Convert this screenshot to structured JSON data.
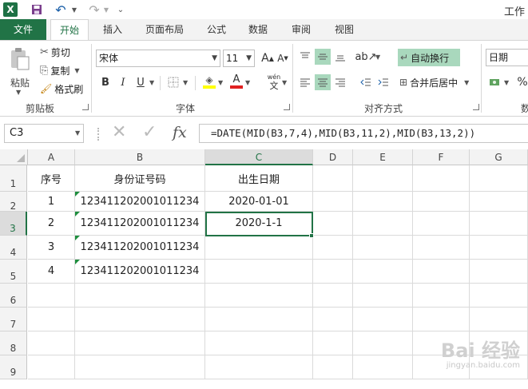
{
  "title": "工作",
  "tabs": [
    "文件",
    "开始",
    "插入",
    "页面布局",
    "公式",
    "数据",
    "审阅",
    "视图"
  ],
  "clipboard": {
    "paste": "粘贴",
    "cut": "剪切",
    "copy": "复制",
    "format_painter": "格式刷",
    "group": "剪贴板"
  },
  "font": {
    "name": "宋体",
    "size": "11",
    "grow": "A",
    "shrink": "A",
    "bold": "B",
    "italic": "I",
    "underline": "U",
    "font_color_letter": "A",
    "phonetic": "wén",
    "phonetic2": "文",
    "group": "字体"
  },
  "alignment": {
    "wrap": "自动换行",
    "merge": "合并后居中",
    "group": "对齐方式"
  },
  "number": {
    "format": "日期",
    "percent": "%",
    "group": "数"
  },
  "name_box": "C3",
  "formula_fx": "fx",
  "formula": "=DATE(MID(B3,7,4),MID(B3,11,2),MID(B3,13,2))",
  "columns": [
    "A",
    "B",
    "C",
    "D",
    "E",
    "F",
    "G"
  ],
  "rows": [
    "1",
    "2",
    "3",
    "4",
    "5",
    "6",
    "7",
    "8",
    "9"
  ],
  "cells": {
    "A1": "序号",
    "B1": "身份证号码",
    "C1": "出生日期",
    "A2": "1",
    "B2": "123411202001011234",
    "C2": "2020-01-01",
    "A3": "2",
    "B3": "123411202001011234",
    "C3": "2020-1-1",
    "A4": "3",
    "B4": "123411202001011234",
    "A5": "4",
    "B5": "123411202001011234"
  },
  "watermark": {
    "brand": "Bai 经验",
    "url": "jingyan.baidu.com"
  },
  "colors": {
    "excel_green": "#217346",
    "highlight": "#a9d8bd",
    "font_red": "#e02020",
    "fill_yellow": "#ffff00"
  }
}
